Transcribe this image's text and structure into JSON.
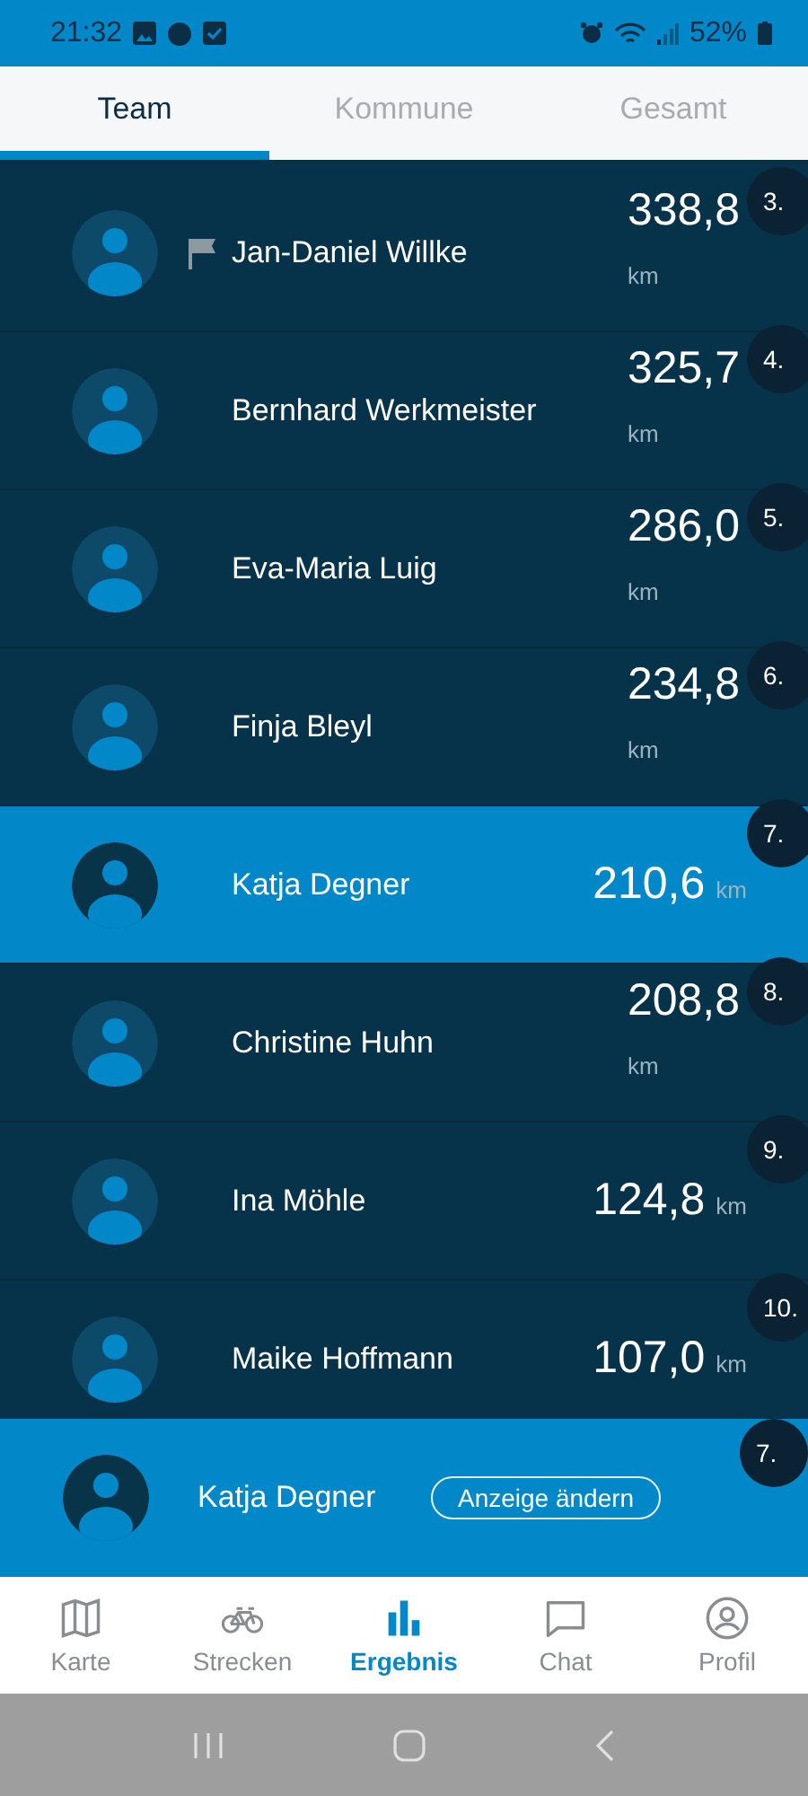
{
  "status_bar": {
    "time": "21:32",
    "battery": "52%"
  },
  "tabs": [
    {
      "label": "Team",
      "selected": true
    },
    {
      "label": "Kommune",
      "selected": false
    },
    {
      "label": "Gesamt",
      "selected": false
    }
  ],
  "rows": [
    {
      "name": "Jan-Daniel Willke",
      "distance": "338,8",
      "unit": "km",
      "rank": "3.",
      "flagged": true,
      "selected": false,
      "kind": "stacked"
    },
    {
      "name": "Bernhard Werkmeister",
      "distance": "325,7",
      "unit": "km",
      "rank": "4.",
      "flagged": false,
      "selected": false,
      "kind": "stacked"
    },
    {
      "name": "Eva-Maria Luig",
      "distance": "286,0",
      "unit": "km",
      "rank": "5.",
      "flagged": false,
      "selected": false,
      "kind": "stacked"
    },
    {
      "name": "Finja Bleyl",
      "distance": "234,8",
      "unit": "km",
      "rank": "6.",
      "flagged": false,
      "selected": false,
      "kind": "stacked"
    },
    {
      "name": "Katja Degner",
      "distance": "210,6",
      "unit": "km",
      "rank": "7.",
      "flagged": false,
      "selected": true,
      "kind": "inline"
    },
    {
      "name": "Christine Huhn",
      "distance": "208,8",
      "unit": "km",
      "rank": "8.",
      "flagged": false,
      "selected": false,
      "kind": "stacked"
    },
    {
      "name": "Ina Möhle",
      "distance": "124,8",
      "unit": "km",
      "rank": "9.",
      "flagged": false,
      "selected": false,
      "kind": "inline"
    },
    {
      "name": "Maike Hoffmann",
      "distance": "107,0",
      "unit": "km",
      "rank": "10.",
      "flagged": false,
      "selected": false,
      "kind": "inline"
    }
  ],
  "current_user": {
    "name": "Katja Degner",
    "button": "Anzeige ändern",
    "rank": "7."
  },
  "bottom_nav": [
    {
      "label": "Karte",
      "kind": "map",
      "selected": false
    },
    {
      "label": "Strecken",
      "kind": "bike",
      "selected": false
    },
    {
      "label": "Ergebnis",
      "kind": "chart",
      "selected": true
    },
    {
      "label": "Chat",
      "kind": "chat",
      "selected": false
    },
    {
      "label": "Profil",
      "kind": "profile",
      "selected": false
    }
  ]
}
